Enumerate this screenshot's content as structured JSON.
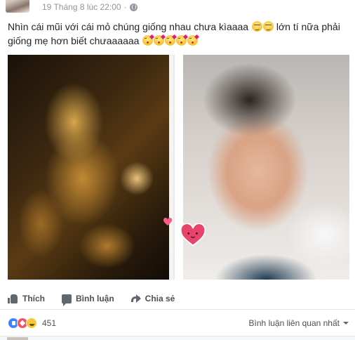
{
  "post": {
    "timestamp": "19 Tháng 8 lúc 22:00",
    "separator": "·",
    "privacy_icon": "globe-icon",
    "message_part1": "Nhìn cái mũi với cái mỏ chúng giống nhau chưa kìaaaa",
    "message_part2": "lớn tí nữa phải giống mẹ hơn biết chưaaaaaa"
  },
  "actions": {
    "like_label": "Thích",
    "comment_label": "Bình luận",
    "share_label": "Chia sẻ"
  },
  "footer": {
    "reaction_count": "451",
    "sort_label": "Bình luận liên quan nhất",
    "reaction_icons": [
      "like-icon",
      "love-icon",
      "haha-icon"
    ]
  },
  "colors": {
    "text": "#1d2129",
    "muted": "#90949c",
    "heart": "#e0245e",
    "like_blue": "#4080ff"
  }
}
